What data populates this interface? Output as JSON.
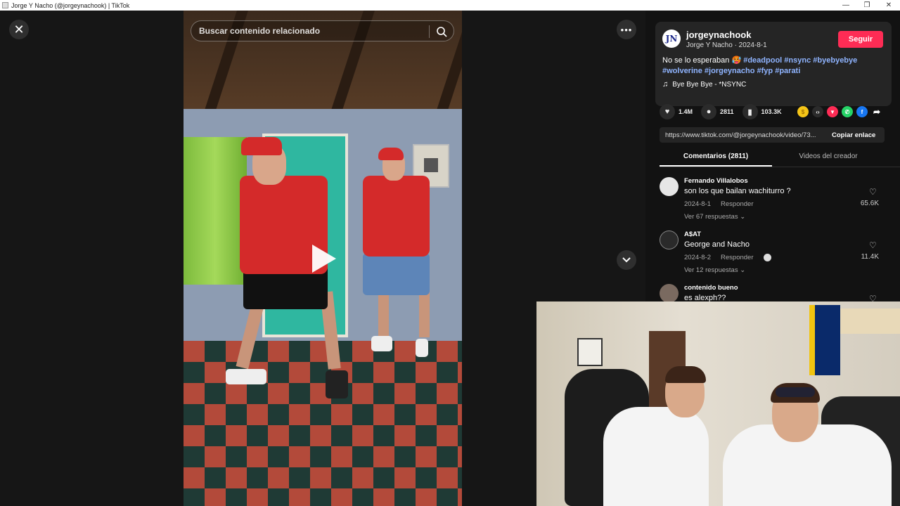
{
  "window": {
    "title": "Jorge Y Nacho (@jorgeynachook) | TikTok",
    "minimize_glyph": "—",
    "restore_glyph": "❐",
    "close_glyph": "✕"
  },
  "player": {
    "close_glyph": "✕",
    "more_glyph": "•••",
    "search_placeholder": "Buscar contenido relacionado"
  },
  "creator": {
    "avatar_initials": "JN",
    "username": "jorgeynachook",
    "display_line": "Jorge Y Nacho · 2024-8-1",
    "follow_label": "Seguir",
    "description_text": "No se lo esperaban 🥵 ",
    "hashtags": [
      "#deadpool",
      "#nsync",
      "#byebyebye",
      "#wolverine",
      "#jorgeynacho",
      "#fyp",
      "#parati"
    ],
    "music": "Bye Bye Bye - *NSYNC"
  },
  "stats": {
    "likes": "1.4M",
    "comments": "2811",
    "saves": "103.3K"
  },
  "share": {
    "url": "https://www.tiktok.com/@jorgeynachook/video/73...",
    "copy_label": "Copiar enlace",
    "colors": {
      "coin": "#f5c518",
      "embed": "#2b2b2b",
      "friends": "#fe2c55",
      "whatsapp": "#25d366",
      "facebook": "#1877f2"
    }
  },
  "tabs": [
    {
      "label": "Comentarios (2811)",
      "active": true
    },
    {
      "label": "Videos del creador",
      "active": false
    }
  ],
  "comments": [
    {
      "name": "Fernando Villalobos",
      "text": "son los que bailan wachiturro ?",
      "date": "2024-8-1",
      "reply": "Responder",
      "more": "Ver 67 respuestas ⌄",
      "likes": "65.6K"
    },
    {
      "name": "A$AT",
      "text": "George and Nacho",
      "date": "2024-8-2",
      "reply": "Responder",
      "more": "Ver 12 respuestas ⌄",
      "likes": "11.4K"
    },
    {
      "name": "contenido bueno",
      "text": "es alexph??",
      "date": "",
      "reply": "",
      "more": "",
      "likes": ""
    }
  ]
}
